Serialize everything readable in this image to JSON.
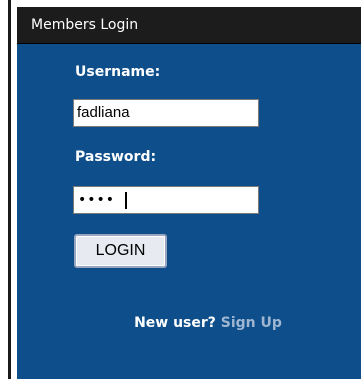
{
  "panel": {
    "title": "Members Login"
  },
  "form": {
    "username_label": "Username:",
    "username_value": "fadliana",
    "password_label": "Password:",
    "password_masked": "••••",
    "login_button": "LOGIN"
  },
  "signup": {
    "prompt": "New user?",
    "link": "Sign Up"
  },
  "colors": {
    "header_bg": "#1c1c1c",
    "panel_bg": "#0e4e8a",
    "link": "#9fb6d3"
  }
}
